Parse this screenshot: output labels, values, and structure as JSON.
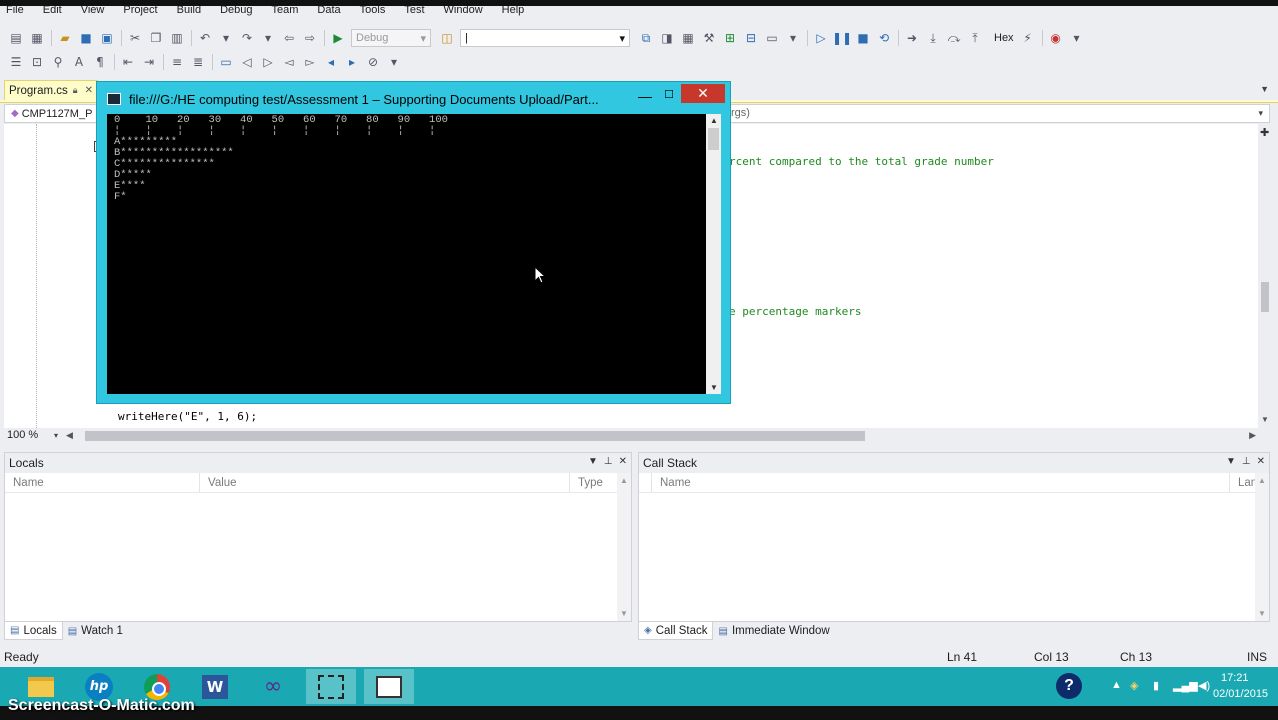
{
  "menu": [
    "File",
    "Edit",
    "View",
    "Project",
    "Build",
    "Debug",
    "Team",
    "Data",
    "Tools",
    "Test",
    "Window",
    "Help"
  ],
  "toolbar": {
    "config_value": "Debug",
    "find_value": "|",
    "hex_label": "Hex"
  },
  "tabs": {
    "active": "Program.cs"
  },
  "navbar": {
    "class_name": "CMP1127M_P",
    "member_fragment": "rgs)"
  },
  "editor": {
    "comment1": "rcent compared to the total grade number",
    "comment2": "e percentage markers",
    "line_a": "writeHere(\"E\", 1, 6);",
    "zoom": "100 %"
  },
  "locals_panel": {
    "title": "Locals",
    "columns": [
      "Name",
      "Value",
      "Type"
    ],
    "tabs": [
      "Locals",
      "Watch 1"
    ]
  },
  "callstack_panel": {
    "title": "Call Stack",
    "columns": [
      "Name",
      "Lang"
    ],
    "tabs": [
      "Call Stack",
      "Immediate Window"
    ]
  },
  "statusbar": {
    "state": "Ready",
    "line": "Ln 41",
    "col": "Col 13",
    "ch": "Ch 13",
    "mode": "INS"
  },
  "console": {
    "title": "file:///G:/HE computing test/Assessment 1 – Supporting Documents Upload/Part...",
    "close_symbol": "✕",
    "lines": [
      "0    10   20   30   40   50   60   70   80   90   100",
      "¦    ¦    ¦    ¦    ¦    ¦    ¦    ¦    ¦    ¦    ¦",
      "A*********",
      "B******************",
      "C***************",
      "D*****",
      "E****",
      "F*"
    ]
  },
  "taskbar": {
    "hp_label": "hp",
    "word_label": "W",
    "help_label": "?",
    "time": "17:21",
    "date": "02/01/2015"
  },
  "watermark": "Screencast-O-Matic.com"
}
